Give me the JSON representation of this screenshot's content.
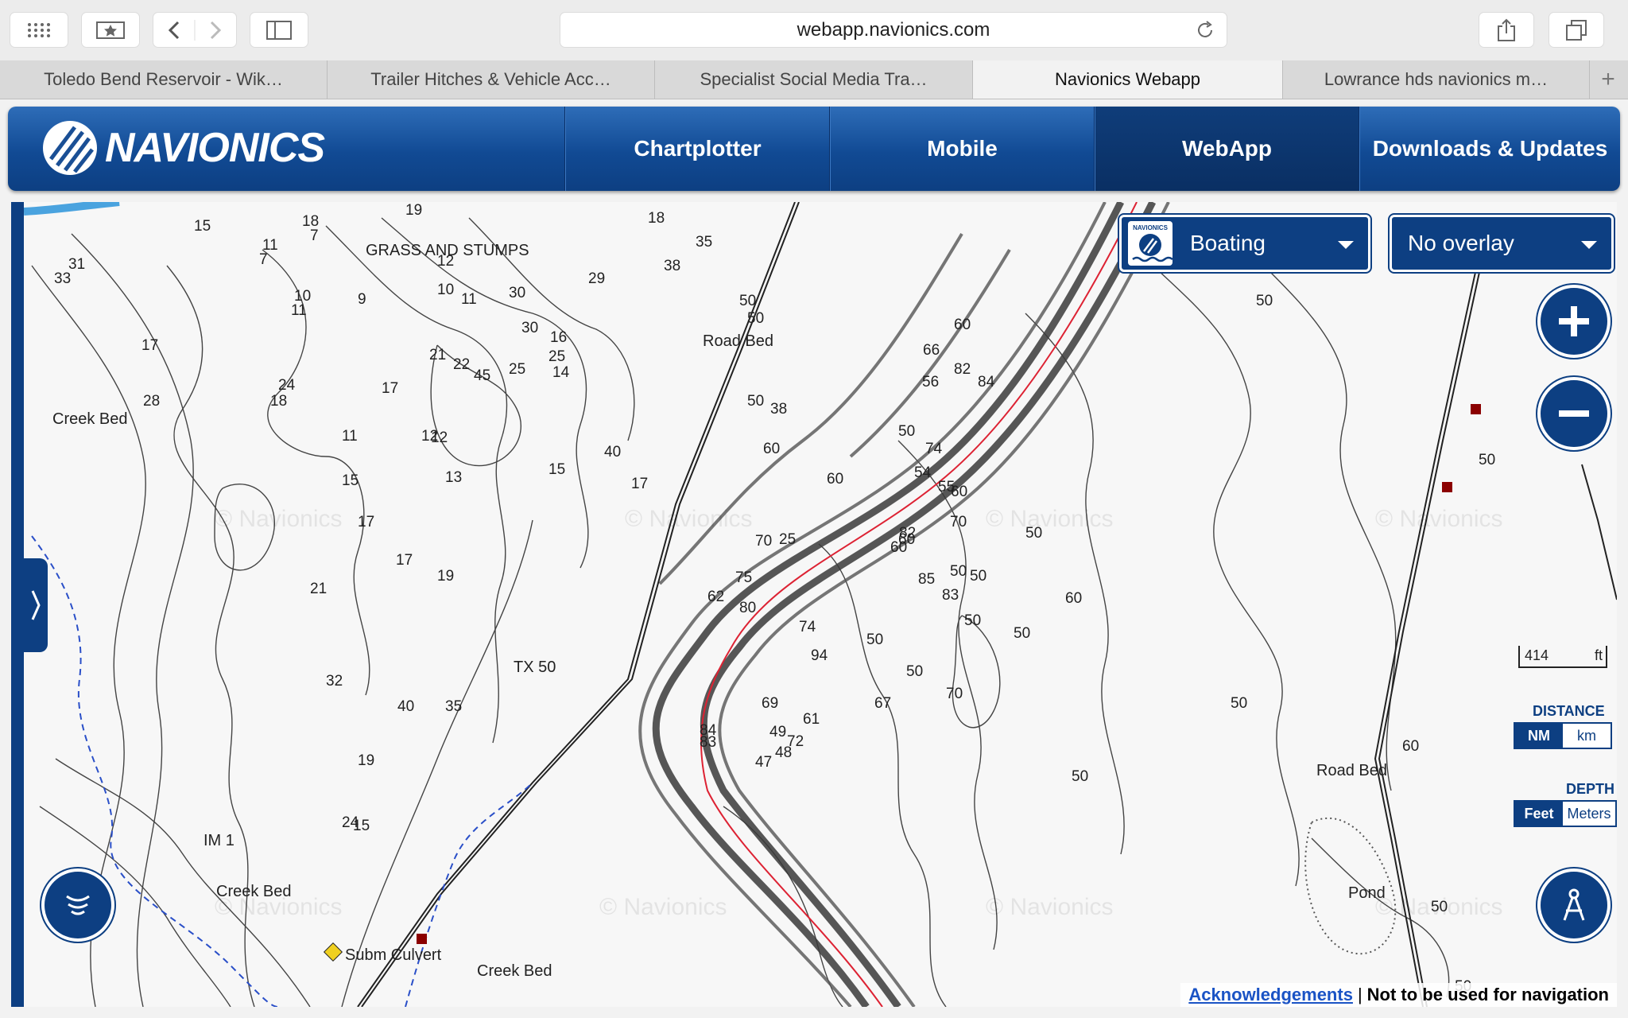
{
  "browser": {
    "url": "webapp.navionics.com",
    "tabs": [
      {
        "label": "Toledo Bend Reservoir - Wik…",
        "active": false
      },
      {
        "label": "Trailer Hitches & Vehicle Acc…",
        "active": false
      },
      {
        "label": "Specialist Social Media Tra…",
        "active": false
      },
      {
        "label": "Navionics Webapp",
        "active": true
      },
      {
        "label": "Lowrance hds navionics m…",
        "active": false
      }
    ]
  },
  "nav": {
    "logo": "NAVIONICS",
    "items": [
      {
        "label": "Chartplotter",
        "active": false
      },
      {
        "label": "Mobile",
        "active": false
      },
      {
        "label": "WebApp",
        "active": true
      },
      {
        "label": "Downloads & Updates",
        "active": false
      }
    ]
  },
  "map": {
    "mode_select": "Boating",
    "mode_badge": "NAVIONICS",
    "overlay_select": "No overlay",
    "scale_value": "414",
    "scale_unit": "ft",
    "distance_label": "DISTANCE",
    "distance_options": [
      "NM",
      "km"
    ],
    "distance_selected": "NM",
    "depth_label": "DEPTH",
    "depth_options": [
      "Feet",
      "Meters"
    ],
    "depth_selected": "Feet",
    "watermark": "© Navionics",
    "labels": {
      "grass": "GRASS AND STUMPS",
      "roadbed1": "Road Bed",
      "roadbed2": "Road Bed",
      "creekbed1": "Creek Bed",
      "creekbed2": "Creek Bed",
      "creekbed3": "Creek Bed",
      "culvert": "Subm Culvert",
      "pond": "Pond",
      "im1": "IM 1",
      "tx50": "TX 50"
    },
    "depths": [
      "15",
      "11",
      "18",
      "19",
      "18",
      "7",
      "7",
      "12",
      "9",
      "11",
      "38",
      "35",
      "31",
      "33",
      "10",
      "11",
      "10",
      "30",
      "29",
      "30",
      "14",
      "16",
      "25",
      "21",
      "22",
      "45",
      "25",
      "24",
      "18",
      "17",
      "28",
      "17",
      "11",
      "12",
      "12",
      "13",
      "15",
      "17",
      "40",
      "50",
      "38",
      "70",
      "50",
      "50",
      "15",
      "17",
      "17",
      "19",
      "21",
      "32",
      "40",
      "35",
      "19",
      "15",
      "24",
      "25",
      "60",
      "50",
      "60",
      "60",
      "70",
      "50",
      "60",
      "50",
      "54",
      "55",
      "56",
      "66",
      "74",
      "82",
      "85",
      "83",
      "84",
      "82",
      "67",
      "61",
      "72",
      "69",
      "60",
      "62",
      "75",
      "74",
      "94",
      "80",
      "47",
      "49",
      "48",
      "84",
      "83",
      "82",
      "50",
      "50",
      "50",
      "70",
      "60",
      "50",
      "50",
      "60",
      "50",
      "50",
      "50",
      "60",
      "50",
      "50",
      "50"
    ]
  },
  "footer": {
    "link": "Acknowledgements",
    "separator": "|",
    "note": "Not to be used for navigation"
  }
}
